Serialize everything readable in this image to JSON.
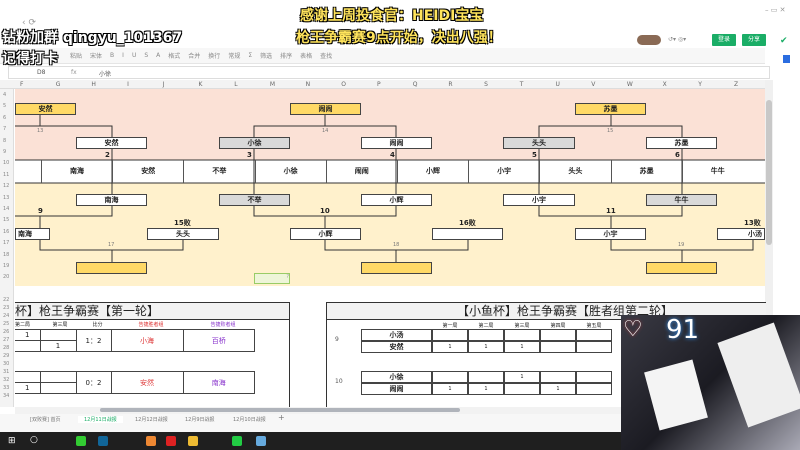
{
  "overlay": {
    "title1": "感谢上周投食官：HEIDI宝宝",
    "title2": "枪王争霸赛9点开始，决出八强！",
    "left1": "钻粉加群 qingyu_101367",
    "left2": "记得打卡",
    "likes": "91"
  },
  "header": {
    "login": "登录",
    "share": "分享"
  },
  "toolbar": {
    "items": [
      "粘贴",
      "宋体",
      "B",
      "I",
      "U",
      "S",
      "A",
      "格式",
      "合并",
      "换行",
      "常规",
      "Σ",
      "筛选",
      "排序",
      "表格",
      "查找"
    ]
  },
  "formula": {
    "cell": "D8",
    "fx": "fx",
    "value": "小徐"
  },
  "columns": [
    "F",
    "G",
    "H",
    "I",
    "J",
    "K",
    "L",
    "M",
    "N",
    "O",
    "P",
    "Q",
    "R",
    "S",
    "T",
    "U",
    "V",
    "W",
    "X",
    "Y",
    "Z"
  ],
  "rows": [
    "4",
    "5",
    "6",
    "7",
    "8",
    "9",
    "10",
    "11",
    "12",
    "13",
    "14",
    "15",
    "16",
    "17",
    "18",
    "19",
    "20",
    "22",
    "23",
    "24",
    "25",
    "26",
    "27",
    "28",
    "29",
    "30",
    "31",
    "32",
    "33",
    "34"
  ],
  "bracket": {
    "top": [
      "安然",
      "闹闹",
      "苏墨"
    ],
    "semi": [
      "安然",
      "小徐",
      "闹闹",
      "头头",
      "苏墨"
    ],
    "row10": [
      "南海",
      "安然",
      "不举",
      "小徐",
      "闹闹",
      "小辉",
      "小宇",
      "头头",
      "苏墨",
      "牛牛"
    ],
    "losers1": [
      "南海",
      "不举",
      "小辉",
      "小宇",
      "牛牛"
    ],
    "losers2": [
      "南海",
      "头头",
      "小辉",
      "",
      "小宇",
      "小汤"
    ],
    "final": [
      "",
      "",
      ""
    ],
    "match_labels": [
      "13",
      "14",
      "15",
      "2",
      "3",
      "4",
      "5",
      "6",
      "9",
      "10",
      "11",
      "15败",
      "16败",
      "13败",
      "17",
      "18",
      "19"
    ],
    "cell_marker": "?"
  },
  "round1": {
    "title": "杯】枪王争霸赛【第一轮】",
    "headers": [
      "第二局",
      "第三局",
      "比分",
      "告捷胜者组",
      "告捷败者组"
    ],
    "matches": [
      {
        "g2a": "1",
        "g3b": "1",
        "score": "1：2",
        "winner": "小海",
        "loser": "百桥"
      },
      {
        "g2b": "1",
        "score": "0：2",
        "winner": "安然",
        "loser": "南海"
      }
    ]
  },
  "round2": {
    "title": "【小鱼杯】枪王争霸赛【胜者组第二轮】",
    "headers": [
      "第一局",
      "第二局",
      "第三局",
      "第四局",
      "第五局"
    ],
    "matches": [
      {
        "no": "9",
        "p1": "小汤",
        "p2": "安然",
        "p1s": [
          "",
          "",
          "",
          "",
          ""
        ],
        "p2s": [
          "1",
          "1",
          "1",
          "",
          ""
        ]
      },
      {
        "no": "10",
        "p1": "小徐",
        "p2": "闹闹",
        "p1s": [
          "",
          "",
          "1",
          "",
          ""
        ],
        "p2s": [
          "1",
          "1",
          "",
          "1",
          ""
        ]
      }
    ]
  },
  "sheets": [
    "[双败赛] 首页",
    "12月11日战报",
    "12月12日战报",
    "12月9日战报",
    "12月10日战报"
  ],
  "colors": {
    "pink": "#fbe1d6",
    "cream": "#fff1cc",
    "gold": "#ffd966",
    "green": "#1aad66"
  }
}
